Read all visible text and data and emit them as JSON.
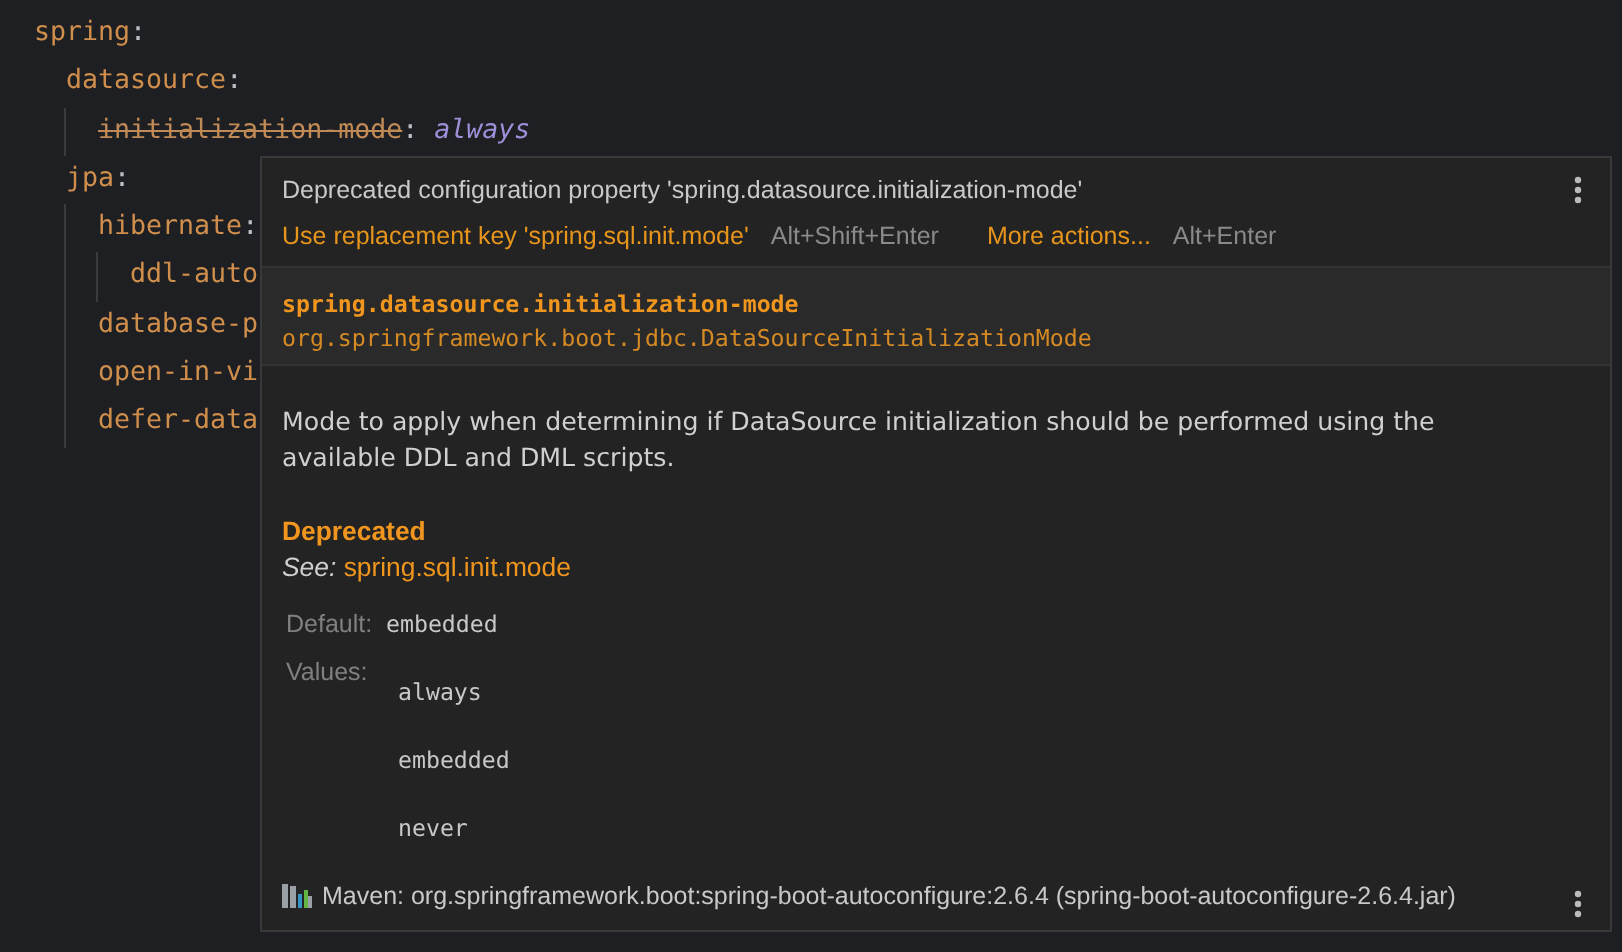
{
  "editor": {
    "lines": [
      {
        "key": "spring",
        "colon": ":",
        "children": [
          {
            "key": "datasource",
            "colon": ":",
            "children": [
              {
                "key": "initialization-mode",
                "colon": ":",
                "value": "always",
                "deprecated": true
              }
            ]
          },
          {
            "key": "jpa",
            "colon": ":",
            "children": [
              {
                "key": "hibernate",
                "colon": ":",
                "children": [
                  {
                    "key": "ddl-auto",
                    "deprecated": false
                  }
                ]
              },
              {
                "key": "database-p",
                "deprecated": false
              },
              {
                "key": "open-in-vi",
                "deprecated": false
              },
              {
                "key": "defer-data",
                "deprecated": false
              }
            ]
          }
        ]
      }
    ]
  },
  "popup": {
    "message": "Deprecated configuration property 'spring.datasource.initialization-mode'",
    "actions": [
      {
        "label": "Use replacement key 'spring.sql.init.mode'",
        "shortcut": "Alt+Shift+Enter"
      },
      {
        "label": "More actions...",
        "shortcut": "Alt+Enter"
      }
    ],
    "property": "spring.datasource.initialization-mode",
    "type": "org.springframework.boot.jdbc.DataSourceInitializationMode",
    "description": "Mode to apply when determining if DataSource initialization should be performed using the available DDL and DML scripts.",
    "deprecated_label": "Deprecated",
    "see_label": "See:",
    "see_link": "spring.sql.init.mode",
    "default_label": "Default:",
    "default_value": "embedded",
    "values_label": "Values:",
    "values": [
      "always",
      "embedded",
      "never"
    ],
    "source": "Maven: org.springframework.boot:spring-boot-autoconfigure:2.6.4 (spring-boot-autoconfigure-2.6.4.jar)"
  }
}
